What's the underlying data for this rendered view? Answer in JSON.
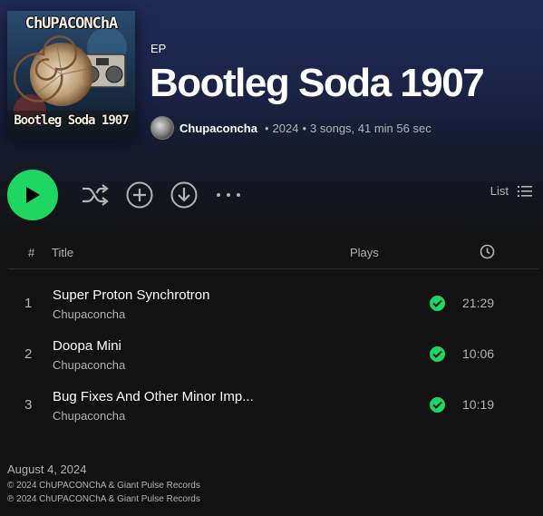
{
  "header": {
    "kind": "EP",
    "title": "Bootleg Soda 1907",
    "artist": "Chupaconcha",
    "year": "2024",
    "stats": "3 songs, 41 min 56 sec",
    "cover": {
      "top_text": "ChUPACONChA",
      "bottom_text": "Bootleg Soda 1907"
    },
    "gradient_color": "#1f2a56"
  },
  "controls": {
    "view_label": "List",
    "accent": "#1ed760"
  },
  "table": {
    "headers": {
      "num": "#",
      "title": "Title",
      "plays": "Plays"
    },
    "tracks": [
      {
        "num": "1",
        "title": "Super Proton Synchrotron",
        "artist": "Chupaconcha",
        "duration": "21:29"
      },
      {
        "num": "2",
        "title": "Doopa Mini",
        "artist": "Chupaconcha",
        "duration": "10:06"
      },
      {
        "num": "3",
        "title": "Bug Fixes And Other Minor Imp...",
        "artist": "Chupaconcha",
        "duration": "10:19"
      }
    ]
  },
  "footer": {
    "date": "August 4, 2024",
    "copyright1": "© 2024 ChUPACONChA & Giant Pulse Records",
    "copyright2": "℗ 2024 ChUPACONChA & Giant Pulse Records"
  }
}
